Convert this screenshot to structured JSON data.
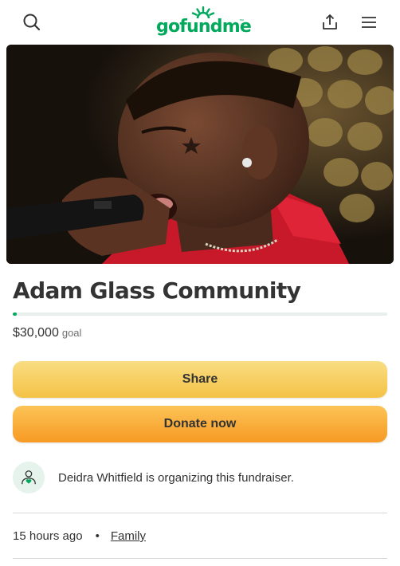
{
  "header": {
    "logo_text": "gofundme",
    "logo_tm": "™",
    "icons": {
      "search": "search-icon",
      "share": "share-upload-icon",
      "menu": "hamburger-menu-icon"
    }
  },
  "hero": {
    "description_icon": "campaign-photo"
  },
  "campaign": {
    "title": "Adam Glass Community",
    "goal_amount": "$30,000",
    "goal_label": "goal",
    "progress_fraction": 0.01
  },
  "actions": {
    "share_label": "Share",
    "donate_label": "Donate now"
  },
  "organizer": {
    "text": "Deidra Whitfield is organizing this fundraiser.",
    "icon": "organizer-heart-person-icon"
  },
  "meta": {
    "time_ago": "15 hours ago",
    "bullet": "•",
    "category": "Family"
  },
  "colors": {
    "brand_green": "#02a95c",
    "share_yellow": "#f4c246",
    "donate_orange": "#f79a24",
    "text_dark": "#333333"
  }
}
